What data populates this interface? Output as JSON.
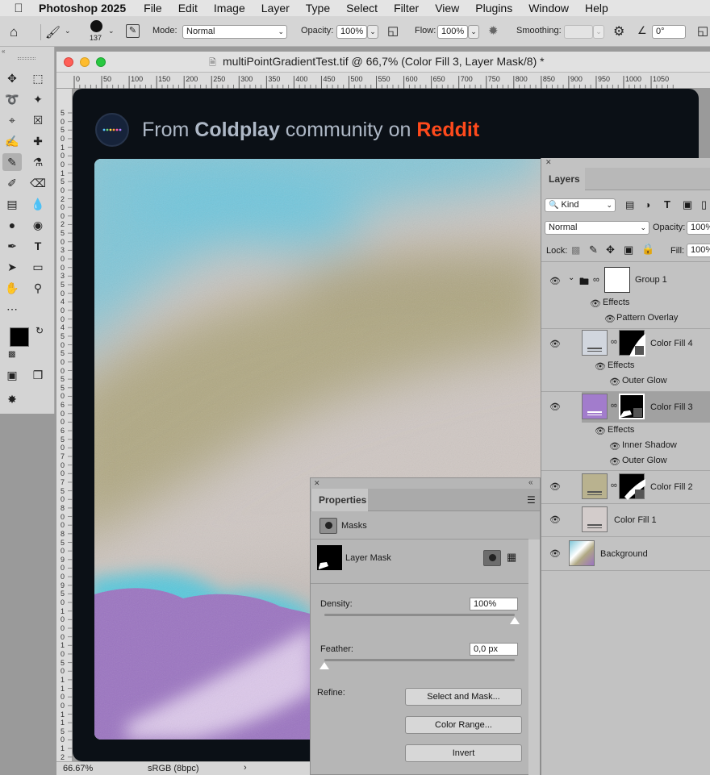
{
  "menubar": {
    "app_name": "Photoshop 2025",
    "items": [
      "File",
      "Edit",
      "Image",
      "Layer",
      "Type",
      "Select",
      "Filter",
      "View",
      "Plugins",
      "Window",
      "Help"
    ]
  },
  "options_bar": {
    "brush_size": "137",
    "mode_label": "Mode:",
    "mode_value": "Normal",
    "opacity_label": "Opacity:",
    "opacity_value": "100%",
    "flow_label": "Flow:",
    "flow_value": "100%",
    "smoothing_label": "Smoothing:",
    "angle_value": "0°"
  },
  "document": {
    "title": "multiPointGradientTest.tif @ 66,7% (Color Fill 3, Layer Mask/8) *",
    "ruler_top": [
      "0",
      "50",
      "100",
      "150",
      "200",
      "250",
      "300",
      "350",
      "400",
      "450",
      "500",
      "550",
      "600",
      "650",
      "700",
      "750",
      "800",
      "850",
      "900",
      "950",
      "1000",
      "1050"
    ],
    "ruler_left": [
      "5",
      "0",
      "5",
      "0",
      "1",
      "0",
      "0",
      "1",
      "5",
      "0",
      "2",
      "0",
      "0",
      "2",
      "5",
      "0",
      "3",
      "0",
      "0",
      "3",
      "5",
      "0",
      "4",
      "0",
      "0",
      "4",
      "5",
      "0",
      "5",
      "0",
      "0",
      "5",
      "5",
      "0",
      "6",
      "0",
      "0",
      "6",
      "5",
      "0",
      "7",
      "0",
      "0",
      "7",
      "5",
      "0",
      "8",
      "0",
      "0",
      "8",
      "5",
      "0",
      "9",
      "0",
      "0",
      "9",
      "5",
      "0",
      "1",
      "0",
      "0",
      "0",
      "1",
      "0",
      "5",
      "0",
      "1",
      "1",
      "0",
      "0",
      "1",
      "1",
      "5",
      "0",
      "1",
      "2",
      "0"
    ],
    "banner": {
      "prefix": "From ",
      "band": "Coldplay",
      "middle": " community on ",
      "site": "Reddit",
      "band_color": "#aeb8c6",
      "site_color": "#ff4a1c"
    },
    "zoom": "66.67%",
    "color_profile": "sRGB (8bpc)"
  },
  "layers_panel": {
    "tab": "Layers",
    "filter_kind": "Kind",
    "blend_mode": "Normal",
    "opacity_label": "Opacity:",
    "opacity_value": "100%",
    "lock_label": "Lock:",
    "fill_label": "Fill:",
    "fill_value": "100%",
    "layers": [
      {
        "name": "Group 1",
        "effects_label": "Effects",
        "effects": [
          "Pattern Overlay"
        ]
      },
      {
        "name": "Color Fill 4",
        "effects_label": "Effects",
        "effects": [
          "Outer Glow"
        ]
      },
      {
        "name": "Color Fill 3",
        "effects_label": "Effects",
        "effects": [
          "Inner Shadow",
          "Outer Glow"
        ]
      },
      {
        "name": "Color Fill 2"
      },
      {
        "name": "Color Fill 1"
      },
      {
        "name": "Background"
      }
    ]
  },
  "properties_panel": {
    "tab": "Properties",
    "section": "Masks",
    "mask_type": "Layer Mask",
    "density_label": "Density:",
    "density_value": "100%",
    "density_level": 1.0,
    "feather_label": "Feather:",
    "feather_value": "0,0 px",
    "feather_level": 0.0,
    "refine_label": "Refine:",
    "buttons": [
      "Select and Mask...",
      "Color Range...",
      "Invert"
    ]
  }
}
